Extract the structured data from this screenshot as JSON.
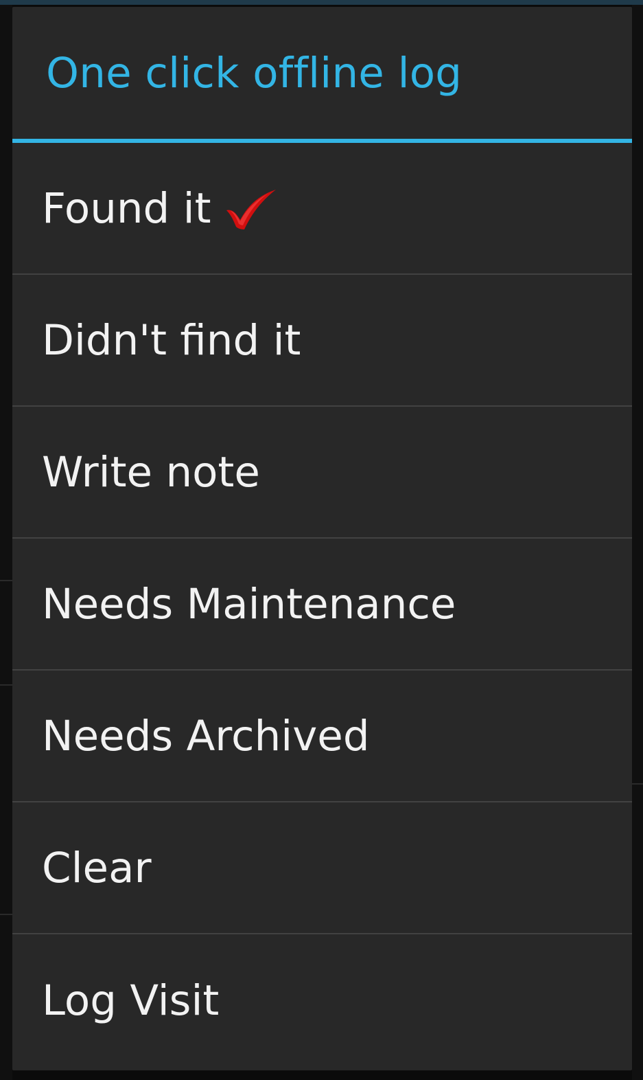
{
  "dialog": {
    "title": "One click offline log",
    "items": [
      {
        "label": "Found it",
        "icon": "red-check-icon",
        "checked": true
      },
      {
        "label": "Didn't find it"
      },
      {
        "label": "Write note"
      },
      {
        "label": "Needs Maintenance"
      },
      {
        "label": "Needs Archived"
      },
      {
        "label": "Clear"
      },
      {
        "label": "Log Visit"
      }
    ]
  },
  "colors": {
    "accent": "#33b5e5",
    "dialog_background": "#282828",
    "divider": "#424242",
    "item_text": "#f2f2f2",
    "check": "#d10f0f"
  }
}
